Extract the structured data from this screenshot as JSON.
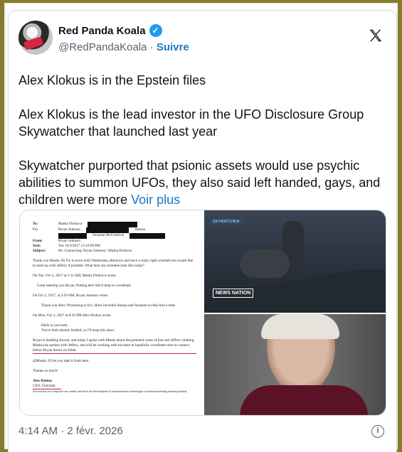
{
  "tweet": {
    "display_name": "Red Panda Koala",
    "handle": "@RedPandaKoala",
    "separator": "·",
    "follow_label": "Suivre",
    "text_main": "Alex Klokus is in the Epstein files\n\nAlex Klokus is the lead investor in the UFO Disclosure Group Skywatcher that launched last year\n\nSkywatcher purported that psionic assets would use psychic abilities to summon UFOs, they also said left handed, gays, and children were more ",
    "see_more": "Voir plus",
    "timestamp": "4:14 AM · 2 févr. 2026",
    "verified_icon": "check",
    "x_logo": "x-logo"
  },
  "media": {
    "doc": {
      "to_label": "To:",
      "to_value": "Masha Drokova",
      "cc_label": "Cc:",
      "cc_value": "Bryan Johnson",
      "cc_right": "Alanna",
      "cc_sub": "Suzanne McGoldrick",
      "from_label": "From:",
      "from_value": "Bryan Johnson",
      "sent_label": "Sent:",
      "sent_value": "Tue 10/3/2017 12:16:09 PM",
      "subject_label": "Subject:",
      "subject_value": "Re: Connecting: Bryan Johnson / Masha Drokova",
      "p1": "Thank you Masha. Hi        I'm in town until Wednesday afternoon and have a really tight schedule but would like to meet up with Jeffery if possible. What does his schedule look like today?",
      "p2": "On Tue, Oct 3, 2017 at 5:11 AM, Masha Drokova                         wrote:",
      "p3": "Great meeting you Bryan. Putting here                     She'll help to coordinate",
      "p4": "On Oct 3, 2017, at 3:59 AM, Bryan Johnson                wrote:",
      "p5": "Thank you Alex! Promoting to bcc. Have included Alanna and Suzanne to help find a time.",
      "p6": "On Mon, Oct 2, 2017 at 8:39 PM Alex Klokus                   wrote:",
      "p7": "Hello to you both,\nYou're both already briefed, so I'll keep this short.",
      "p8": "Bryan is building Kernel, and today I spoke with Masha about the potential value of him and Jeffery chatting. Masha has spoken with Jeffery, and will be working with his team to hopefully coordinate time to connect before Bryan leaves on Weds.",
      "p9": "@Masha: I'll let you take it from here.",
      "p10": "Thanks so much!",
      "sig_name": "Alex Klokus",
      "sig_title": "CEO, Futurism",
      "footer": "Our mission is to empower our readers and drive the development of transformative technologies towards maximizing human potential."
    },
    "top_tag": "SKYWATCHER",
    "news_tag": "NEWS NATION"
  },
  "icons": {
    "info": "info-icon"
  }
}
